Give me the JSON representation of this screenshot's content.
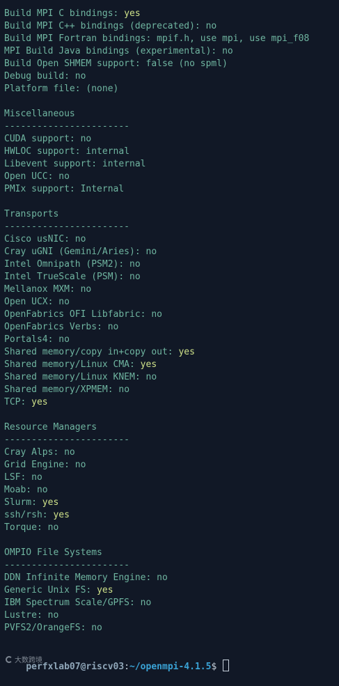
{
  "sections": [
    {
      "header": null,
      "divider": null,
      "lines": [
        {
          "label": "Build MPI C bindings: ",
          "value": "yes"
        },
        {
          "label": "Build MPI C++ bindings (deprecated): ",
          "value": "no"
        },
        {
          "label": "Build MPI Fortran bindings: ",
          "value": "mpif.h, use mpi, use mpi_f08"
        },
        {
          "label": "MPI Build Java bindings (experimental): ",
          "value": "no"
        },
        {
          "label": "Build Open SHMEM support: ",
          "value": "false (no spml)"
        },
        {
          "label": "Debug build: ",
          "value": "no"
        },
        {
          "label": "Platform file: ",
          "value": "(none)"
        }
      ]
    },
    {
      "header": "Miscellaneous",
      "divider": "-----------------------",
      "lines": [
        {
          "label": "CUDA support: ",
          "value": "no"
        },
        {
          "label": "HWLOC support: ",
          "value": "internal"
        },
        {
          "label": "Libevent support: ",
          "value": "internal"
        },
        {
          "label": "Open UCC: ",
          "value": "no"
        },
        {
          "label": "PMIx support: ",
          "value": "Internal"
        }
      ]
    },
    {
      "header": "Transports",
      "divider": "-----------------------",
      "lines": [
        {
          "label": "Cisco usNIC: ",
          "value": "no"
        },
        {
          "label": "Cray uGNI (Gemini/Aries): ",
          "value": "no"
        },
        {
          "label": "Intel Omnipath (PSM2): ",
          "value": "no"
        },
        {
          "label": "Intel TrueScale (PSM): ",
          "value": "no"
        },
        {
          "label": "Mellanox MXM: ",
          "value": "no"
        },
        {
          "label": "Open UCX: ",
          "value": "no"
        },
        {
          "label": "OpenFabrics OFI Libfabric: ",
          "value": "no"
        },
        {
          "label": "OpenFabrics Verbs: ",
          "value": "no"
        },
        {
          "label": "Portals4: ",
          "value": "no"
        },
        {
          "label": "Shared memory/copy in+copy out: ",
          "value": "yes"
        },
        {
          "label": "Shared memory/Linux CMA: ",
          "value": "yes"
        },
        {
          "label": "Shared memory/Linux KNEM: ",
          "value": "no"
        },
        {
          "label": "Shared memory/XPMEM: ",
          "value": "no"
        },
        {
          "label": "TCP: ",
          "value": "yes"
        }
      ]
    },
    {
      "header": "Resource Managers",
      "divider": "-----------------------",
      "lines": [
        {
          "label": "Cray Alps: ",
          "value": "no"
        },
        {
          "label": "Grid Engine: ",
          "value": "no"
        },
        {
          "label": "LSF: ",
          "value": "no"
        },
        {
          "label": "Moab: ",
          "value": "no"
        },
        {
          "label": "Slurm: ",
          "value": "yes"
        },
        {
          "label": "ssh/rsh: ",
          "value": "yes"
        },
        {
          "label": "Torque: ",
          "value": "no"
        }
      ]
    },
    {
      "header": "OMPIO File Systems",
      "divider": "-----------------------",
      "lines": [
        {
          "label": "DDN Infinite Memory Engine: ",
          "value": "no"
        },
        {
          "label": "Generic Unix FS: ",
          "value": "yes"
        },
        {
          "label": "IBM Spectrum Scale/GPFS: ",
          "value": "no"
        },
        {
          "label": "Lustre: ",
          "value": "no"
        },
        {
          "label": "PVFS2/OrangeFS: ",
          "value": "no"
        }
      ]
    }
  ],
  "prompt": {
    "user_host": "perfxlab07@riscv03",
    "separator": ":",
    "path": "~/openmpi-4.1.5",
    "symbol": "$ "
  },
  "watermark": {
    "text": "大数跨境"
  },
  "colors": {
    "background": "#111826",
    "text": "#6fb5a0",
    "yes_value": "#cfe28a",
    "path": "#3aa3d6"
  }
}
